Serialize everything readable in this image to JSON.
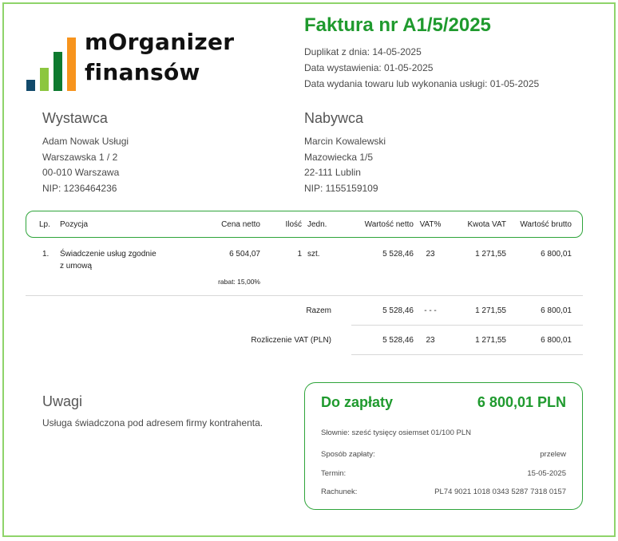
{
  "logo": {
    "line1": "mOrganizer",
    "line2": "finansów"
  },
  "invoice": {
    "title": "Faktura nr A1/5/2025",
    "duplicate": "Duplikat z dnia: 14-05-2025",
    "issue_date": "Data wystawienia: 01-05-2025",
    "delivery_date": "Data wydania towaru lub wykonania usługi: 01-05-2025"
  },
  "seller": {
    "heading": "Wystawca",
    "name": "Adam Nowak Usługi",
    "street": "Warszawska 1 / 2",
    "city": "00-010 Warszawa",
    "nip": "NIP: 1236464236"
  },
  "buyer": {
    "heading": "Nabywca",
    "name": "Marcin Kowalewski",
    "street": "Mazowiecka 1/5",
    "city": "22-111 Lublin",
    "nip": "NIP: 1155159109"
  },
  "table": {
    "headers": {
      "lp": "Lp.",
      "item": "Pozycja",
      "net_price": "Cena netto",
      "qty": "Ilość",
      "unit": "Jedn.",
      "net_value": "Wartość netto",
      "vat_rate": "VAT%",
      "vat_amount": "Kwota VAT",
      "gross_value": "Wartość brutto"
    },
    "rows": [
      {
        "lp": "1.",
        "item_line1": "Świadczenie usług zgodnie",
        "item_line2": "z umową",
        "net_price": "6 504,07",
        "discount": "rabat: 15,00%",
        "qty": "1",
        "unit": "szt.",
        "net_value": "5 528,46",
        "vat_rate": "23",
        "vat_amount": "1 271,55",
        "gross_value": "6 800,01"
      }
    ],
    "total": {
      "label": "Razem",
      "net_value": "5 528,46",
      "vat_rate": "- - -",
      "vat_amount": "1 271,55",
      "gross_value": "6 800,01"
    },
    "vat_summary": {
      "label": "Rozliczenie VAT (PLN)",
      "net_value": "5 528,46",
      "vat_rate": "23",
      "vat_amount": "1 271,55",
      "gross_value": "6 800,01"
    }
  },
  "notes": {
    "heading": "Uwagi",
    "text": "Usługa świadczona pod adresem firmy kontrahenta."
  },
  "payment": {
    "label": "Do zapłaty",
    "amount": "6 800,01 PLN",
    "in_words": "Słownie: sześć tysięcy osiemset 01/100 PLN",
    "method_label": "Sposób zapłaty:",
    "method_value": "przelew",
    "due_label": "Termin:",
    "due_value": "15-05-2025",
    "account_label": "Rachunek:",
    "account_value": "PL74 9021 1018 0343 5287 7318 0157"
  },
  "colors": {
    "accent_green": "#1f9a2e",
    "frame_green": "#8fd46a"
  }
}
